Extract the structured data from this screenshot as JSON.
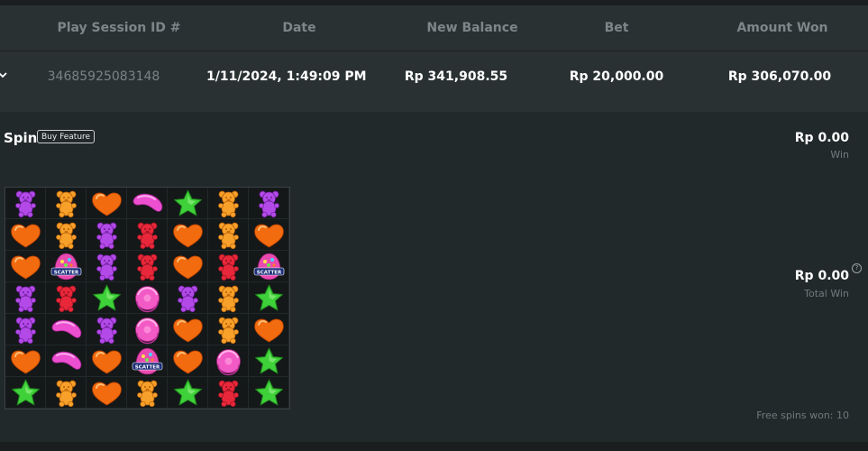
{
  "table": {
    "headers": [
      "Play Session ID #",
      "Date",
      "New Balance",
      "Bet",
      "Amount Won"
    ],
    "row": {
      "session_id": "34685925083148",
      "date": "1/11/2024, 1:49:09 PM",
      "new_balance": "Rp 341,908.55",
      "bet": "Rp 20,000.00",
      "amount_won": "Rp 306,070.00"
    }
  },
  "details": {
    "title": "Spin",
    "badge": "Buy Feature",
    "win_amount": "Rp 0.00",
    "win_label": "Win",
    "total_win_amount": "Rp 0.00",
    "total_win_label": "Total Win",
    "free_spins": "Free spins won: 10",
    "scatter_label": "SCATTER"
  },
  "colors": {
    "background": "#22292a",
    "row_background": "#2a3133",
    "header_text": "#7d8689",
    "muted_text": "#6f7a7d"
  },
  "grid": {
    "columns": 7,
    "rows": 7,
    "symbols": [
      [
        "purple-bear",
        "orange-bear",
        "orange-heart",
        "pink-bean",
        "green-star",
        "orange-bear",
        "purple-bear"
      ],
      [
        "orange-heart",
        "orange-bear",
        "purple-bear",
        "red-bear",
        "orange-heart",
        "orange-bear",
        "orange-heart"
      ],
      [
        "orange-heart",
        "scatter",
        "purple-bear",
        "red-bear",
        "orange-heart",
        "red-bear",
        "scatter"
      ],
      [
        "purple-bear",
        "red-bear",
        "green-star",
        "pink-lollipop",
        "purple-bear",
        "orange-bear",
        "green-star"
      ],
      [
        "purple-bear",
        "pink-bean",
        "purple-bear",
        "pink-lollipop",
        "orange-heart",
        "orange-bear",
        "orange-heart"
      ],
      [
        "orange-heart",
        "pink-bean",
        "orange-heart",
        "scatter",
        "orange-heart",
        "pink-lollipop",
        "green-star"
      ],
      [
        "green-star",
        "orange-bear",
        "orange-heart",
        "orange-bear",
        "green-star",
        "red-bear",
        "green-star"
      ]
    ]
  }
}
